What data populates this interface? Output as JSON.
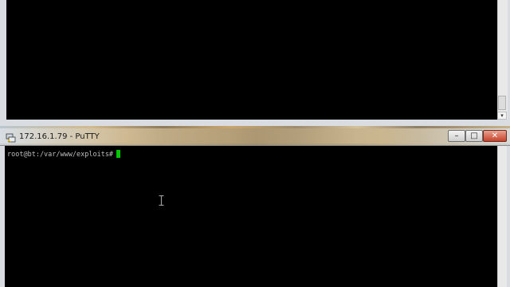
{
  "windows": {
    "top": {
      "app": "PuTTY"
    },
    "main": {
      "title": "172.16.1.79 - PuTTY",
      "controls": {
        "minimize": "–",
        "maximize": "□",
        "close": "✕"
      },
      "terminal": {
        "prompt": "root@bt:/var/www/exploits#"
      }
    }
  },
  "colors": {
    "terminal_bg": "#000000",
    "terminal_text": "#bfbfbf",
    "cursor": "#00c800",
    "close_button": "#c7432b"
  },
  "icons": {
    "title": "putty-icon",
    "pointer": "ibeam-cursor-icon"
  }
}
